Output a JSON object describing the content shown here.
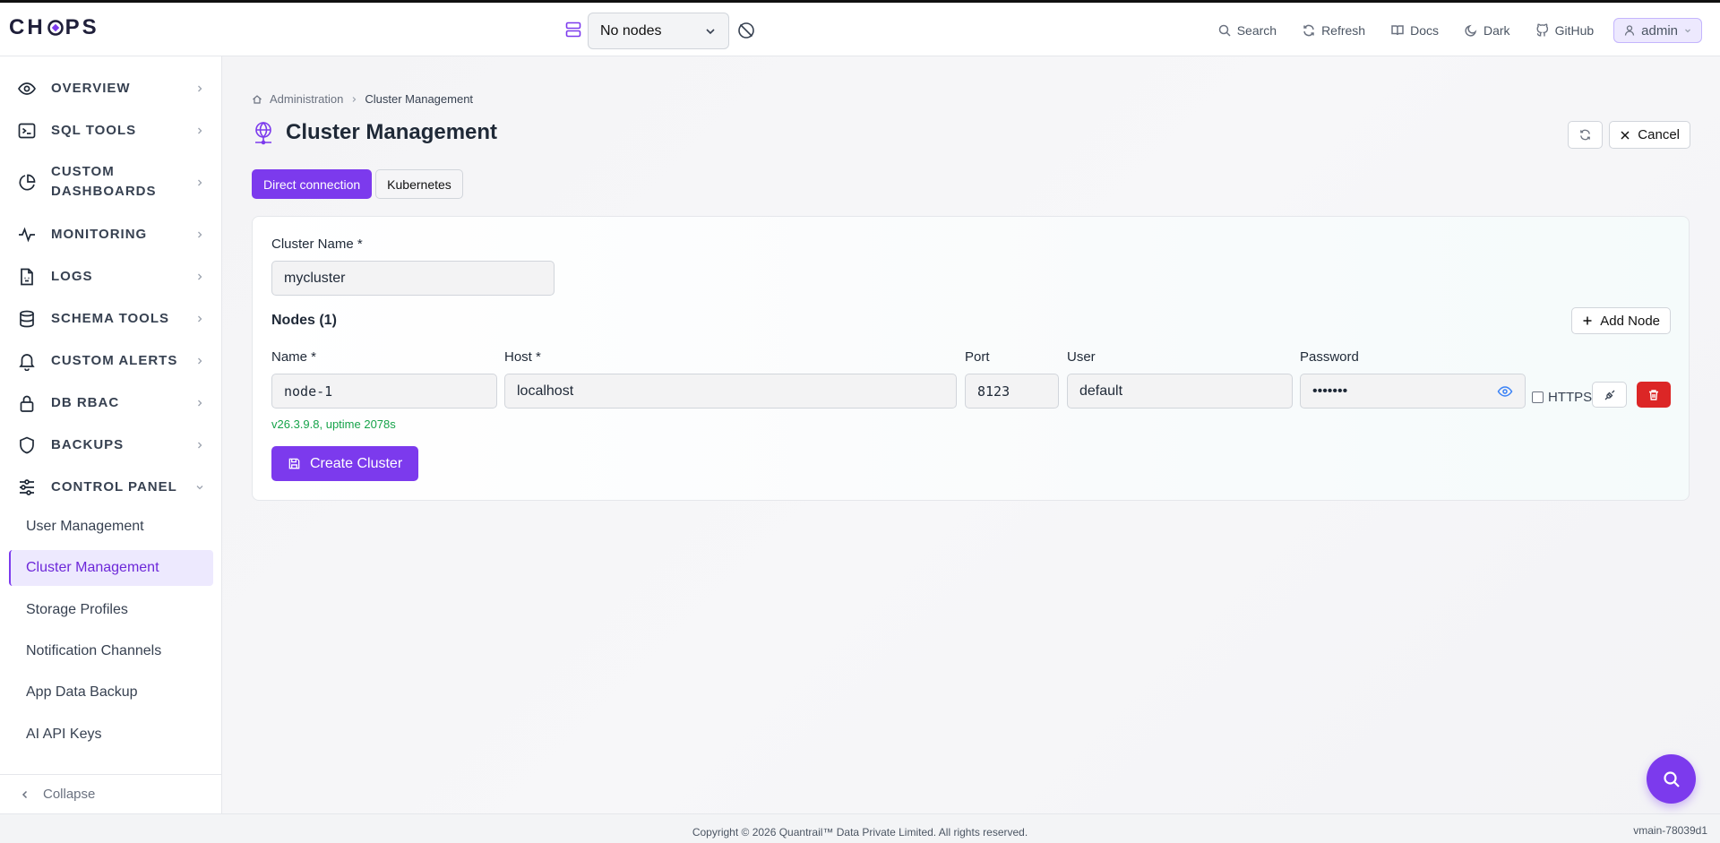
{
  "app": {
    "logo": "CHOPS"
  },
  "topbar": {
    "node_select": "No nodes",
    "actions": [
      "Search",
      "Refresh",
      "Docs",
      "Dark",
      "GitHub"
    ],
    "user": "admin"
  },
  "sidebar": {
    "items": [
      {
        "label": "OVERVIEW",
        "icon": "eye-icon"
      },
      {
        "label": "SQL TOOLS",
        "icon": "terminal-icon"
      },
      {
        "label": "CUSTOM",
        "label2": "DASHBOARDS",
        "icon": "pie-chart-icon"
      },
      {
        "label": "MONITORING",
        "icon": "activity-icon"
      },
      {
        "label": "LOGS",
        "icon": "file-icon"
      },
      {
        "label": "SCHEMA TOOLS",
        "icon": "database-icon"
      },
      {
        "label": "CUSTOM ALERTS",
        "icon": "bell-icon"
      },
      {
        "label": "DB RBAC",
        "icon": "lock-icon"
      },
      {
        "label": "BACKUPS",
        "icon": "shield-icon"
      },
      {
        "label": "CONTROL PANEL",
        "icon": "sliders-icon"
      }
    ],
    "sub_items": [
      "User Management",
      "Cluster Management",
      "Storage Profiles",
      "Notification Channels",
      "App Data Backup",
      "AI API Keys"
    ],
    "active_sub": "Cluster Management",
    "collapse": "Collapse"
  },
  "main": {
    "breadcrumb": [
      "Administration",
      "Cluster Management"
    ],
    "title": "Cluster Management",
    "cancel": "Cancel",
    "tabs": [
      "Direct connection",
      "Kubernetes"
    ],
    "form": {
      "cluster_name_label": "Cluster Name *",
      "cluster_name_value": "mycluster",
      "nodes_title": "Nodes (1)",
      "add_node": "Add Node",
      "columns": {
        "name": "Name *",
        "host": "Host *",
        "port": "Port",
        "user": "User",
        "password": "Password"
      },
      "node": {
        "name": "node-1",
        "host": "localhost",
        "port": "8123",
        "user": "default",
        "password": "•••••••"
      },
      "https_label": "HTTPS",
      "version": "v26.3.9.8, uptime 2078s",
      "create": "Create Cluster"
    }
  },
  "footer": {
    "copyright": "Copyright © 2026 Quantrail™ Data Private Limited. All rights reserved.",
    "build": "vmain-78039d1"
  },
  "colors": {
    "accent": "#7c3aed",
    "danger": "#dc2626",
    "success": "#16a34a"
  }
}
